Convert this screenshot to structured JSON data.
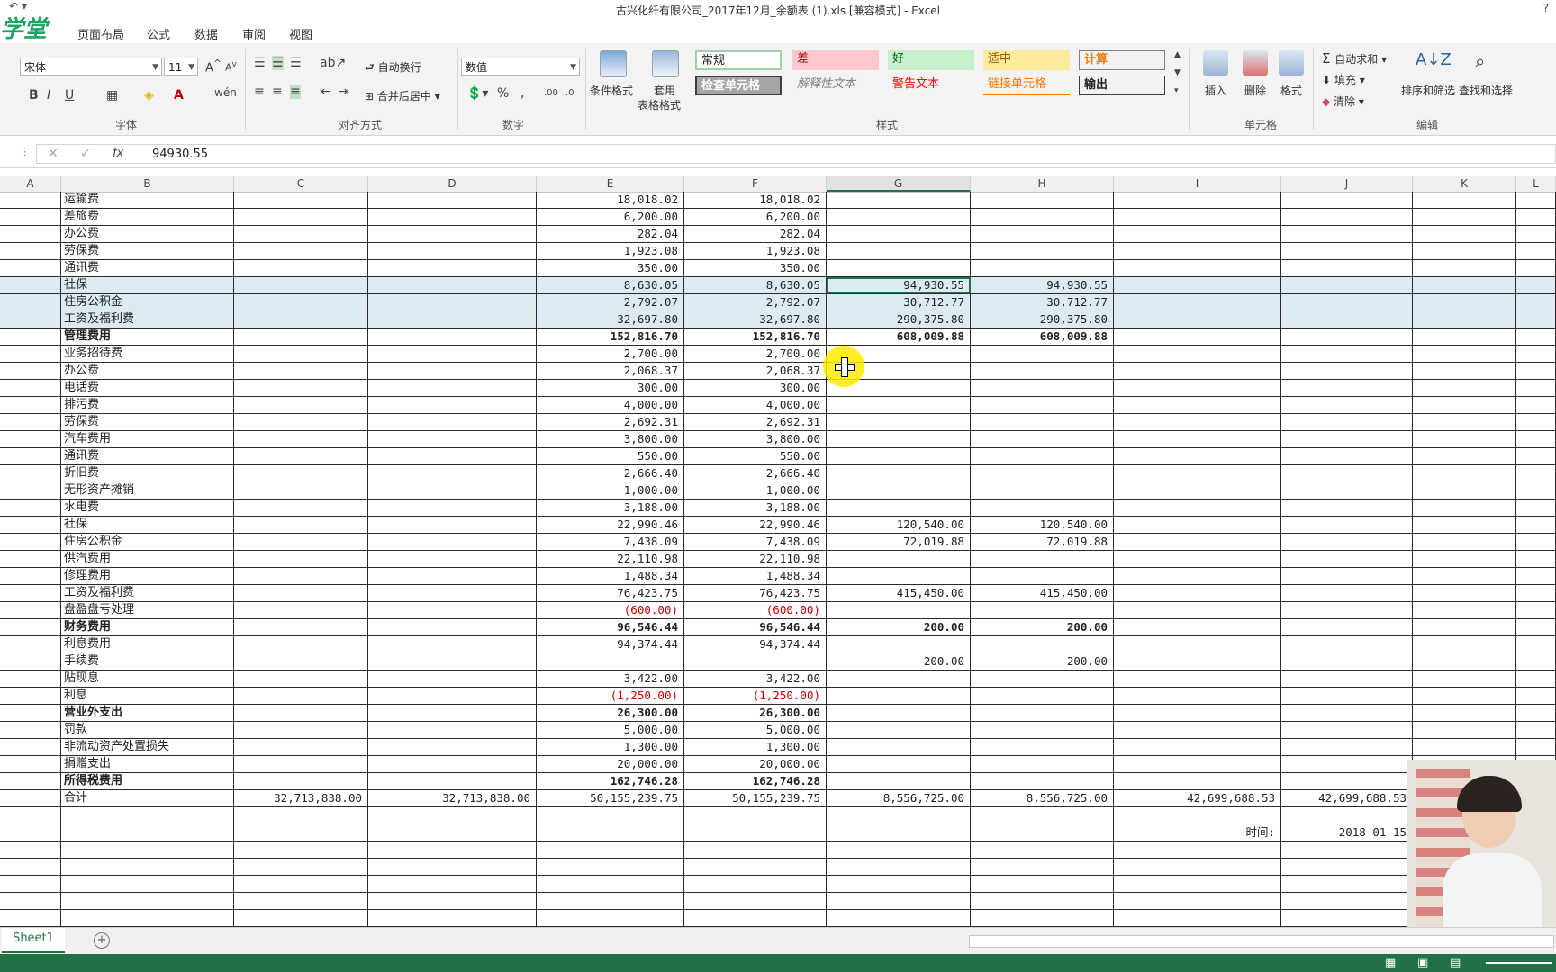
{
  "window": {
    "title": "古兴化纤有限公司_2017年12月_余额表 (1).xls  [兼容模式] - Excel",
    "logo": "学堂",
    "help": "?"
  },
  "menu_tabs": [
    "页面布局",
    "公式",
    "数据",
    "审阅",
    "视图"
  ],
  "ribbon": {
    "font_name": "宋体",
    "font_size": "11",
    "font_group": "字体",
    "align_group": "对齐方式",
    "wrap_text": "自动换行",
    "merge_center": "合并后居中",
    "number_format": "数值",
    "number_group": "数字",
    "cond_format": "条件格式",
    "table_format_1": "套用",
    "table_format_2": "表格格式",
    "styles_group": "样式",
    "styles": {
      "normal": "常规",
      "bad": "差",
      "good": "好",
      "neutral": "适中",
      "calc": "计算",
      "check": "检查单元格",
      "explain": "解释性文本",
      "warn": "警告文本",
      "link": "链接单元格",
      "output": "输出"
    },
    "insert": "插入",
    "delete": "删除",
    "format": "格式",
    "cells_group": "单元格",
    "autosum": "自动求和",
    "fill": "填充",
    "clear": "清除",
    "sort_filter": "排序和筛选",
    "find_select": "查找和选择",
    "edit_group": "编辑"
  },
  "formula_bar": {
    "fx": "fx",
    "value": "94930.55"
  },
  "columns": [
    "A",
    "B",
    "C",
    "D",
    "E",
    "F",
    "G",
    "H",
    "I",
    "J",
    "K",
    "L"
  ],
  "rows": [
    {
      "b": "运输费",
      "e": "18,018.02",
      "f": "18,018.02"
    },
    {
      "b": "差旅费",
      "e": "6,200.00",
      "f": "6,200.00"
    },
    {
      "b": "办公费",
      "e": "282.04",
      "f": "282.04"
    },
    {
      "b": "劳保费",
      "e": "1,923.08",
      "f": "1,923.08"
    },
    {
      "b": "通讯费",
      "e": "350.00",
      "f": "350.00"
    },
    {
      "b": "社保",
      "e": "8,630.05",
      "f": "8,630.05",
      "g": "94,930.55",
      "h": "94,930.55",
      "hl": true
    },
    {
      "b": "住房公积金",
      "e": "2,792.07",
      "f": "2,792.07",
      "g": "30,712.77",
      "h": "30,712.77",
      "hl": true
    },
    {
      "b": "工资及福利费",
      "e": "32,697.80",
      "f": "32,697.80",
      "g": "290,375.80",
      "h": "290,375.80",
      "hl": true
    },
    {
      "b": "管理费用",
      "e": "152,816.70",
      "f": "152,816.70",
      "g": "608,009.88",
      "h": "608,009.88",
      "bold": true
    },
    {
      "b": "业务招待费",
      "e": "2,700.00",
      "f": "2,700.00"
    },
    {
      "b": "办公费",
      "e": "2,068.37",
      "f": "2,068.37"
    },
    {
      "b": "电话费",
      "e": "300.00",
      "f": "300.00"
    },
    {
      "b": "排污费",
      "e": "4,000.00",
      "f": "4,000.00"
    },
    {
      "b": "劳保费",
      "e": "2,692.31",
      "f": "2,692.31"
    },
    {
      "b": "汽车费用",
      "e": "3,800.00",
      "f": "3,800.00"
    },
    {
      "b": "通讯费",
      "e": "550.00",
      "f": "550.00"
    },
    {
      "b": "折旧费",
      "e": "2,666.40",
      "f": "2,666.40"
    },
    {
      "b": "无形资产摊销",
      "e": "1,000.00",
      "f": "1,000.00"
    },
    {
      "b": "水电费",
      "e": "3,188.00",
      "f": "3,188.00"
    },
    {
      "b": "社保",
      "e": "22,990.46",
      "f": "22,990.46",
      "g": "120,540.00",
      "h": "120,540.00"
    },
    {
      "b": "住房公积金",
      "e": "7,438.09",
      "f": "7,438.09",
      "g": "72,019.88",
      "h": "72,019.88"
    },
    {
      "b": "供汽费用",
      "e": "22,110.98",
      "f": "22,110.98"
    },
    {
      "b": "修理费用",
      "e": "1,488.34",
      "f": "1,488.34"
    },
    {
      "b": "工资及福利费",
      "e": "76,423.75",
      "f": "76,423.75",
      "g": "415,450.00",
      "h": "415,450.00"
    },
    {
      "b": "盘盈盘亏处理",
      "e": "(600.00)",
      "f": "(600.00)",
      "neg": true
    },
    {
      "b": "财务费用",
      "e": "96,546.44",
      "f": "96,546.44",
      "g": "200.00",
      "h": "200.00",
      "bold": true
    },
    {
      "b": "利息费用",
      "e": "94,374.44",
      "f": "94,374.44"
    },
    {
      "b": "手续费",
      "g": "200.00",
      "h": "200.00"
    },
    {
      "b": "贴现息",
      "e": "3,422.00",
      "f": "3,422.00"
    },
    {
      "b": "利息",
      "e": "(1,250.00)",
      "f": "(1,250.00)",
      "neg": true
    },
    {
      "b": "营业外支出",
      "e": "26,300.00",
      "f": "26,300.00",
      "bold": true
    },
    {
      "b": "罚款",
      "e": "5,000.00",
      "f": "5,000.00"
    },
    {
      "b": "非流动资产处置损失",
      "e": "1,300.00",
      "f": "1,300.00"
    },
    {
      "b": "捐赠支出",
      "e": "20,000.00",
      "f": "20,000.00"
    },
    {
      "b": "所得税费用",
      "e": "162,746.28",
      "f": "162,746.28",
      "bold": true
    },
    {
      "b": "合计",
      "c": "32,713,838.00",
      "d": "32,713,838.00",
      "e": "50,155,239.75",
      "f": "50,155,239.75",
      "g": "8,556,725.00",
      "h": "8,556,725.00",
      "i": "42,699,688.53",
      "j": "42,699,688.53"
    },
    {
      "b": ""
    },
    {
      "i": "时间:",
      "j": "2018-01-15"
    },
    {
      "b": ""
    },
    {
      "b": ""
    },
    {
      "b": ""
    },
    {
      "b": ""
    },
    {
      "b": ""
    }
  ],
  "sheet_tab": "Sheet1",
  "colors": {
    "excel_green": "#217346",
    "highlight_row": "#dcebf3",
    "negative": "#c00000"
  }
}
